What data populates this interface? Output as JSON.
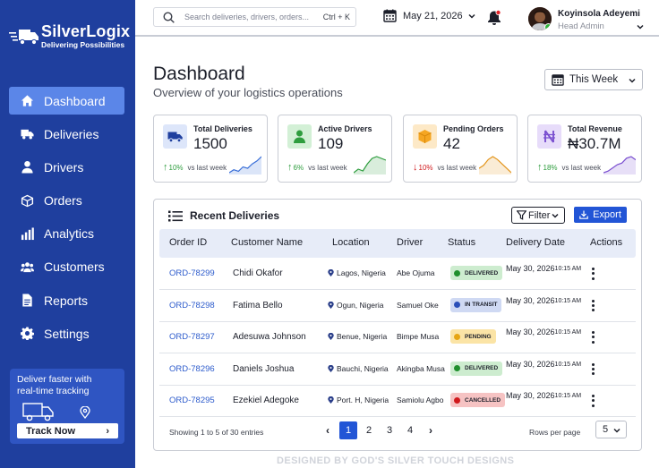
{
  "brand": {
    "name_part1": "Silver",
    "name_part2": "Logix",
    "tagline": "Delivering Possibilities"
  },
  "sidebar": {
    "items": [
      {
        "label": "Dashboard",
        "icon": "home-icon",
        "active": true
      },
      {
        "label": "Deliveries",
        "icon": "truck-icon"
      },
      {
        "label": "Drivers",
        "icon": "user-icon"
      },
      {
        "label": "Orders",
        "icon": "box-icon"
      },
      {
        "label": "Analytics",
        "icon": "bar-chart-icon"
      },
      {
        "label": "Customers",
        "icon": "users-icon"
      },
      {
        "label": "Reports",
        "icon": "document-icon"
      },
      {
        "label": "Settings",
        "icon": "gear-icon"
      }
    ],
    "promo": {
      "text": "Deliver faster with real-time tracking",
      "button": "Track Now"
    }
  },
  "topbar": {
    "search_placeholder": "Search deliveries, drivers, orders...",
    "shortcut": "Ctrl + K",
    "date": "May  21, 2026",
    "user": {
      "name": "Koyinsola Adeyemi",
      "role": "Head Admin"
    }
  },
  "header": {
    "title": "Dashboard",
    "subtitle": "Overview of your logistics operations",
    "period": "This Week"
  },
  "stats": [
    {
      "label": "Total Deliveries",
      "value": "1500",
      "delta": "10%",
      "direction": "up",
      "vs": "vs last week",
      "icon": "truck-icon",
      "color": "#3a6fd8",
      "bg": "#dde6fa",
      "spark": [
        4,
        6,
        5,
        8,
        7,
        10,
        12,
        15
      ]
    },
    {
      "label": "Active Drivers",
      "value": "109",
      "delta": "6%",
      "direction": "up",
      "vs": "vs last week",
      "icon": "driver-icon",
      "color": "#2e9d3e",
      "bg": "#d3f0d6",
      "spark": [
        4,
        6,
        5,
        9,
        12,
        13,
        12,
        11
      ]
    },
    {
      "label": "Pending Orders",
      "value": "42",
      "delta": "10%",
      "direction": "down",
      "vs": "vs last week",
      "icon": "package-icon",
      "color": "#e3951c",
      "bg": "#fde9c7",
      "spark": [
        6,
        8,
        12,
        14,
        12,
        9,
        6,
        3
      ]
    },
    {
      "label": "Total Revenue",
      "value": "₦30.7M",
      "delta": "18%",
      "direction": "up",
      "vs": "vs last week",
      "icon": "naira-icon",
      "color": "#7a4fd0",
      "bg": "#e7dcfa",
      "spark": [
        4,
        5,
        7,
        9,
        10,
        13,
        14,
        12
      ]
    }
  ],
  "table": {
    "title": "Recent Deliveries",
    "filter_label": "Filter",
    "export_label": "Export",
    "columns": [
      "Order ID",
      "Customer Name",
      "Location",
      "Driver",
      "Status",
      "Delivery Date",
      "Actions"
    ],
    "rows": [
      {
        "id": "ORD-78299",
        "customer": "Chidi Okafor",
        "location": "Lagos, Nigeria",
        "driver": "Abe Ojuma",
        "status": "DELIVERED",
        "date": "May  30, 2026",
        "time": "10:15 AM"
      },
      {
        "id": "ORD-78298",
        "customer": "Fatima Bello",
        "location": "Ogun, Nigeria",
        "driver": "Samuel Oke",
        "status": "IN TRANSIT",
        "date": "May  30, 2026",
        "time": "10:15 AM"
      },
      {
        "id": "ORD-78297",
        "customer": "Adesuwa Johnson",
        "location": "Benue, Nigeria",
        "driver": "Bimpe Musa",
        "status": "PENDING",
        "date": "May  30, 2026",
        "time": "10:15 AM"
      },
      {
        "id": "ORD-78296",
        "customer": "Daniels Joshua",
        "location": "Bauchi, Nigeria",
        "driver": "Akingba Musa",
        "status": "DELIVERED",
        "date": "May  30, 2026",
        "time": "10:15 AM"
      },
      {
        "id": "ORD-78295",
        "customer": "Ezekiel Adegoke",
        "location": "Port. H, Nigeria",
        "driver": "Samiolu Agbo",
        "status": "CANCELLED",
        "date": "May  30, 2026",
        "time": "10:15 AM"
      }
    ],
    "status_colors": {
      "DELIVERED": {
        "bg": "#cdeccf",
        "dot": "#1f8f2c"
      },
      "IN TRANSIT": {
        "bg": "#cfd9f3",
        "dot": "#2b4fb8"
      },
      "PENDING": {
        "bg": "#fbe4a6",
        "dot": "#e6a514"
      },
      "CANCELLED": {
        "bg": "#f6c3c3",
        "dot": "#d0191c"
      }
    },
    "footer": {
      "showing": "Showing 1 to 5 of 30 entries",
      "pages": [
        "1",
        "2",
        "3",
        "4"
      ],
      "current_page": "1",
      "rows_per_page_label": "Rows per page",
      "rows_per_page": "5"
    }
  },
  "watermark": "DESIGNED BY GOD'S SILVER TOUCH DESIGNS"
}
